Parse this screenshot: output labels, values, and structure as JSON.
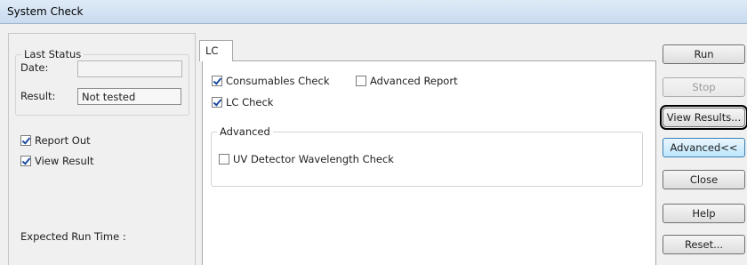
{
  "window": {
    "title": "System Check"
  },
  "last_status": {
    "legend": "Last Status",
    "date_label": "Date:",
    "date_value": "",
    "result_label": "Result:",
    "result_value": "Not tested"
  },
  "options": {
    "report_out": {
      "label": "Report Out",
      "checked": true
    },
    "view_result": {
      "label": "View Result",
      "checked": true
    }
  },
  "expected_run_time": {
    "label": "Expected Run Time :"
  },
  "tabs": [
    {
      "label": "LC",
      "selected": true
    }
  ],
  "lc_tab": {
    "consumables_check": {
      "label": "Consumables Check",
      "checked": true
    },
    "advanced_report": {
      "label": "Advanced Report",
      "checked": false
    },
    "lc_check": {
      "label": "LC Check",
      "checked": true
    },
    "advanced_group": {
      "legend": "Advanced",
      "uv_detector": {
        "label": "UV Detector Wavelength Check",
        "checked": false
      }
    }
  },
  "buttons": {
    "run": "Run",
    "stop": "Stop",
    "view_results": "View Results...",
    "advanced": "Advanced<<",
    "close": "Close",
    "help": "Help",
    "reset": "Reset..."
  }
}
